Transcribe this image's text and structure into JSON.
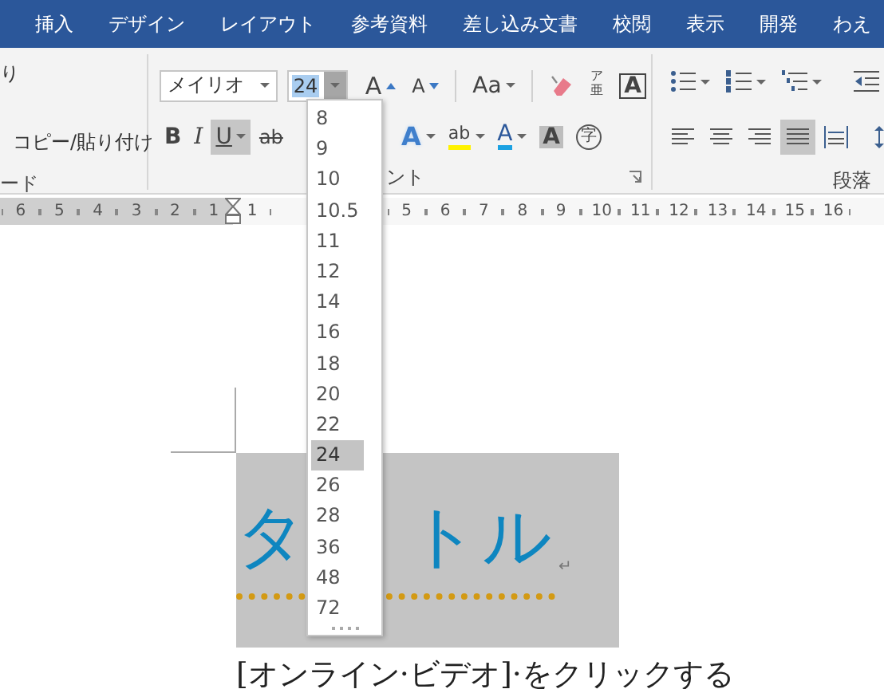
{
  "tabs": [
    {
      "label": "挿入"
    },
    {
      "label": "デザイン"
    },
    {
      "label": "レイアウト"
    },
    {
      "label": "参考資料"
    },
    {
      "label": "差し込み文書"
    },
    {
      "label": "校閲"
    },
    {
      "label": "表示"
    },
    {
      "label": "開発"
    },
    {
      "label": "わえ"
    }
  ],
  "clipboard": {
    "items": [
      "り",
      "コピー/貼り付け"
    ],
    "group_label": "ード"
  },
  "font_group": {
    "font_name": "メイリオ",
    "font_size": "24",
    "row_1": [
      {
        "kind": "grow",
        "glyph": "A"
      },
      {
        "kind": "shrink",
        "glyph": "A"
      },
      {
        "kind": "case",
        "glyph": "Aa",
        "menu": true
      },
      {
        "kind": "clear"
      },
      {
        "kind": "phonetic",
        "glyph": "ア",
        "glyph_2": "亜"
      },
      {
        "kind": "border",
        "glyph": "A"
      }
    ],
    "row_2": [
      {
        "kind": "bold",
        "glyph": "B",
        "on": false
      },
      {
        "kind": "italic",
        "glyph": "I",
        "on": false
      },
      {
        "kind": "underline",
        "glyph": "U",
        "on": true,
        "menu": true
      },
      {
        "kind": "strike",
        "glyph": "ab"
      },
      {
        "kind": "effects",
        "glyph": "A",
        "menu": true
      },
      {
        "kind": "highlight",
        "glyph": "ab",
        "menu": true
      },
      {
        "kind": "color",
        "glyph": "A",
        "menu": true
      },
      {
        "kind": "shading",
        "glyph": "A"
      },
      {
        "kind": "enclose",
        "glyph": "字"
      }
    ],
    "group_label": "ント"
  },
  "paragraph_group": {
    "row_1": [
      {
        "kind": "bullets",
        "menu": true
      },
      {
        "kind": "numbering",
        "menu": true
      },
      {
        "kind": "multilevel",
        "menu": true
      },
      {
        "kind": "outdent"
      }
    ],
    "row_2": [
      {
        "kind": "left",
        "on": false
      },
      {
        "kind": "center",
        "on": false
      },
      {
        "kind": "right",
        "on": false
      },
      {
        "kind": "justify",
        "on": true
      },
      {
        "kind": "distribute",
        "on": false
      },
      {
        "kind": "spacing"
      }
    ],
    "group_label": "段落"
  },
  "ruler": {
    "left_numbers": [
      "6",
      "5",
      "4",
      "3",
      "2",
      "1"
    ],
    "right_numbers": [
      "1",
      "5",
      "6",
      "7",
      "8",
      "9",
      "10",
      "11",
      "12",
      "13",
      "14",
      "15",
      "16"
    ]
  },
  "size_list": {
    "items": [
      {
        "label": "8",
        "selected": false
      },
      {
        "label": "9",
        "selected": false
      },
      {
        "label": "10",
        "selected": false
      },
      {
        "label": "10.5",
        "selected": false
      },
      {
        "label": "11",
        "selected": false
      },
      {
        "label": "12",
        "selected": false
      },
      {
        "label": "14",
        "selected": false
      },
      {
        "label": "16",
        "selected": false
      },
      {
        "label": "18",
        "selected": false
      },
      {
        "label": "20",
        "selected": false
      },
      {
        "label": "22",
        "selected": false
      },
      {
        "label": "24",
        "selected": true
      },
      {
        "label": "26",
        "selected": false
      },
      {
        "label": "28",
        "selected": false
      },
      {
        "label": "36",
        "selected": false
      },
      {
        "label": "48",
        "selected": false
      },
      {
        "label": "72",
        "selected": false
      }
    ]
  },
  "document": {
    "title_parts": [
      "タ",
      "トル"
    ],
    "paragraph_mark": "↵",
    "body": "[オンライン·ビデオ]·をクリックする"
  }
}
